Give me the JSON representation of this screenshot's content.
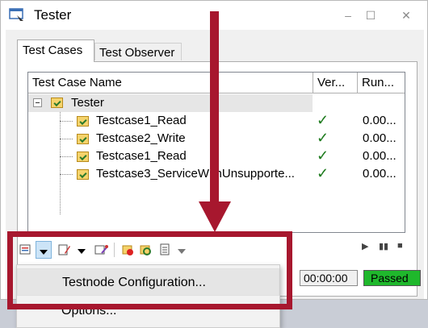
{
  "window": {
    "title": "Tester",
    "controls": {
      "minimize": "–",
      "maximize": "☐",
      "close": "✕"
    }
  },
  "tabs": [
    {
      "label": "Test Cases",
      "active": true
    },
    {
      "label": "Test Observer",
      "active": false
    }
  ],
  "grid": {
    "columns": [
      "Test Case Name",
      "Ver...",
      "Run..."
    ],
    "root": {
      "name": "Tester"
    },
    "rows": [
      {
        "name": "Testcase1_Read",
        "verdict": "✓",
        "run": "0.00..."
      },
      {
        "name": "Testcase2_Write",
        "verdict": "✓",
        "run": "0.00..."
      },
      {
        "name": "Testcase1_Read",
        "verdict": "✓",
        "run": "0.00..."
      },
      {
        "name": "Testcase3_ServiceWithUnsupporte...",
        "verdict": "✓",
        "run": "0.00..."
      }
    ]
  },
  "toolbar": {
    "icons": [
      "testnode-config-icon",
      "dropdown-arrow-icon",
      "edit-icon",
      "dropdown-arrow-icon",
      "wizard-icon",
      "stop-icon",
      "refresh-icon",
      "document-icon",
      "dropdown-arrow-icon"
    ],
    "media": {
      "play": "▶",
      "pause": "▮▮",
      "stop": "■"
    }
  },
  "status": {
    "time": "00:00:00",
    "result": "Passed",
    "result_color": "#1fb82c"
  },
  "dropdown_menu": {
    "items": [
      {
        "label": "Testnode Configuration..."
      },
      {
        "label": "Options..."
      }
    ]
  },
  "annotation_color": "#a7172e"
}
